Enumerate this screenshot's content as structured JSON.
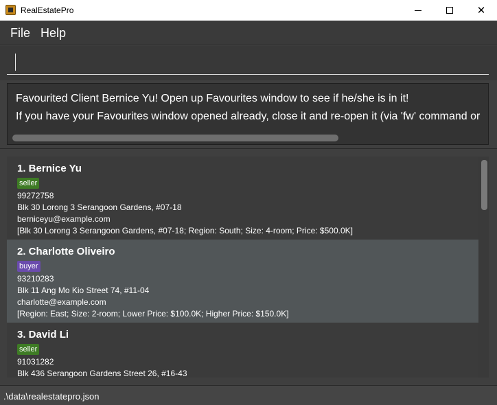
{
  "window": {
    "title": "RealEstatePro",
    "icon": "app-logo-icon",
    "controls": {
      "minimize": "minimize-icon",
      "maximize": "maximize-icon",
      "close": "close-icon",
      "close_glyph": "✕"
    }
  },
  "menu": {
    "file": "File",
    "help": "Help"
  },
  "command": {
    "value": ""
  },
  "result": {
    "line1": "Favourited Client Bernice Yu! Open up Favourites window to see if he/she is in it!",
    "line2": "If you have your Favourites window opened already, close it and re-open it (via 'fw' command or"
  },
  "clients": [
    {
      "index_name": "1.  Bernice Yu",
      "tag": "seller",
      "tag_color": "#3e7b25",
      "phone": "99272758",
      "address": "Blk 30 Lorong 3 Serangoon Gardens, #07-18",
      "email": "berniceyu@example.com",
      "details": "[Blk 30 Lorong 3 Serangoon Gardens, #07-18; Region: South; Size: 4-room; Price: $500.0K]"
    },
    {
      "index_name": "2.  Charlotte Oliveiro",
      "tag": "buyer",
      "tag_color": "#6a4bad",
      "phone": "93210283",
      "address": "Blk 11 Ang Mo Kio Street 74, #11-04",
      "email": "charlotte@example.com",
      "details": "[Region: East; Size: 2-room; Lower Price: $100.0K; Higher Price: $150.0K]"
    },
    {
      "index_name": "3.  David Li",
      "tag": "seller",
      "tag_color": "#3e7b25",
      "phone": "91031282",
      "address": "Blk 436 Serangoon Gardens Street 26, #16-43",
      "email": "",
      "details": ""
    }
  ],
  "status": {
    "file_path": ".\\data\\realestatepro.json"
  },
  "colors": {
    "background": "#3f3f3f",
    "selected_row": "#515658",
    "seller_tag": "#3e7b25",
    "buyer_tag": "#6a4bad"
  }
}
